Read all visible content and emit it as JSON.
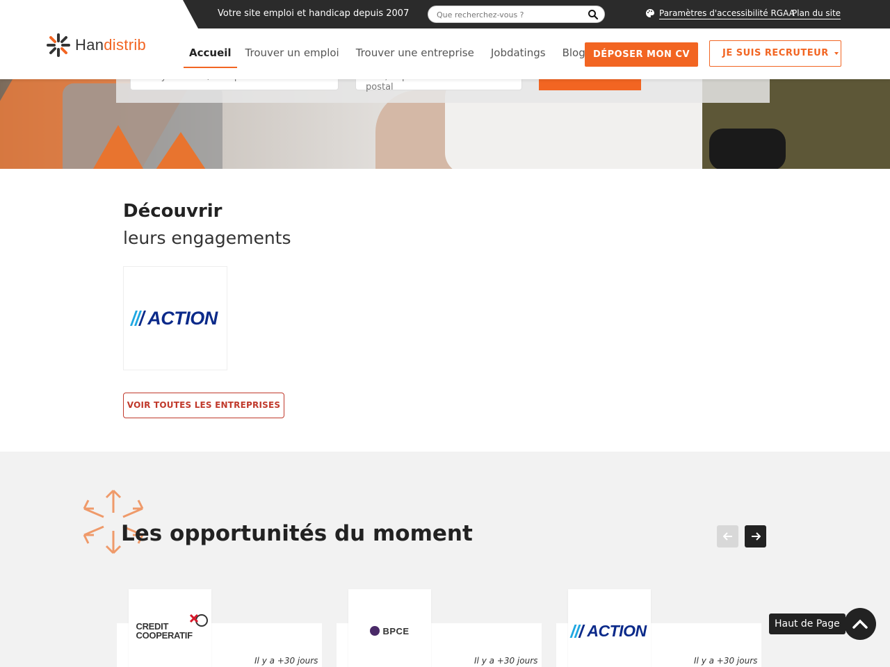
{
  "topbar": {
    "tagline": "Votre site emploi et handicap depuis 2007",
    "search_placeholder": "Que recherchez-vous ?",
    "accessibility_label": "Paramètres d'accessibilité RGAA",
    "sitemap_label": "Plan du site"
  },
  "logo": {
    "part1": "Han",
    "part2": "di",
    "part3": "strib"
  },
  "nav": {
    "items": [
      {
        "label": "Accueil",
        "active": true
      },
      {
        "label": "Trouver un emploi"
      },
      {
        "label": "Trouver une entreprise"
      },
      {
        "label": "Jobdatings"
      },
      {
        "label": "Blog"
      }
    ],
    "cv_button": "DÉPOSER MON CV",
    "recruiter_button": "JE SUIS RECRUTEUR"
  },
  "hero": {
    "query_placeholder": "Essayer : CDD / Comptable",
    "location_placeholder": "Ville, département ou code postal"
  },
  "engagements": {
    "title": "Découvrir",
    "subtitle": "leurs engagements",
    "company": "ACTION",
    "all_button": "VOIR TOUTES LES ENTREPRISES"
  },
  "opportunities": {
    "title": "Les opportunités du moment",
    "cards": [
      {
        "company": "CREDIT COOPERATIF",
        "date": "Il y a +30 jours"
      },
      {
        "company": "BPCE",
        "date": "Il y a +30 jours"
      },
      {
        "company": "ACTION",
        "date": "Il y a +30 jours"
      }
    ]
  },
  "back_to_top": "Haut de Page",
  "colors": {
    "brand_orange": "#f26522",
    "action_blue": "#0b2a8a",
    "action_cyan": "#1ea7e1",
    "dark": "#222222"
  }
}
